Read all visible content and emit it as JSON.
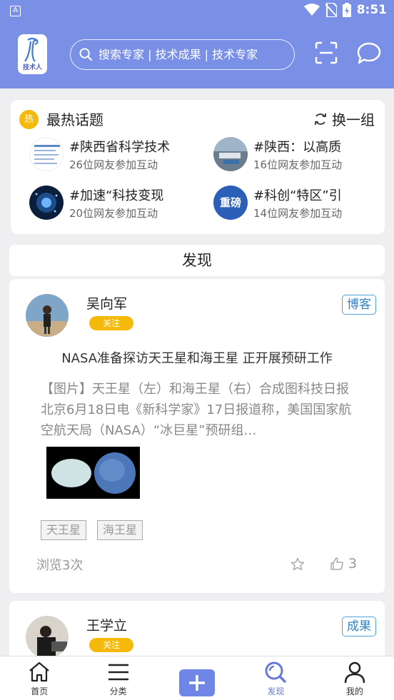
{
  "status_bar": {
    "time": "8:51"
  },
  "header": {
    "logo_text": "技术人",
    "search_placeholder": "搜索专家 | 技术成果 | 技术专家"
  },
  "hot_topics": {
    "badge": "热",
    "title": "最热话题",
    "refresh_label": "换一组",
    "items": [
      {
        "title": "#陕西省科学技术",
        "participants": "26位网友参加互动"
      },
      {
        "title": "#陕西：以高质",
        "participants": "16位网友参加互动"
      },
      {
        "title": "#加速“科技变现",
        "participants": "20位网友参加互动"
      },
      {
        "title": "#科创“特区”引",
        "participants": "14位网友参加互动"
      }
    ],
    "thumb_text_4": "重磅"
  },
  "discover_title": "发现",
  "posts": [
    {
      "author": "吴向军",
      "follow_label": "关注",
      "type": "博客",
      "title": "NASA准备探访天王星和海王星 正开展预研工作",
      "excerpt": "【图片】天王星（左）和海王星（右）合成图科技日报北京6月18日电《新科学家》17日报道称，美国国家航空航天局（NASA）“冰巨星”预研组…",
      "tags": [
        "天王星",
        "海王星"
      ],
      "views": "浏览3次",
      "likes": "3"
    },
    {
      "author": "王学立",
      "follow_label": "关注",
      "type": "成果"
    }
  ],
  "bottom_nav": [
    {
      "label": "首页"
    },
    {
      "label": "分类"
    },
    {
      "label": ""
    },
    {
      "label": "发现"
    },
    {
      "label": "我的"
    }
  ],
  "colors": {
    "header_bg": "#7a8fe6",
    "accent_yellow": "#f5b90c",
    "tag_blue": "#2d86c5",
    "active_nav": "#6a79d8"
  }
}
